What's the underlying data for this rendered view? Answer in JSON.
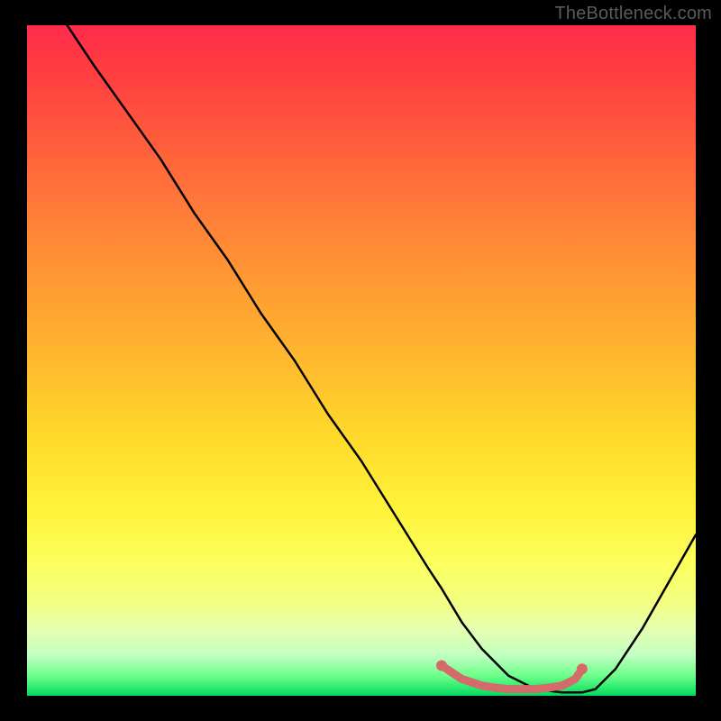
{
  "watermark": "TheBottleneck.com",
  "chart_data": {
    "type": "line",
    "title": "",
    "xlabel": "",
    "ylabel": "",
    "xlim": [
      0,
      100
    ],
    "ylim": [
      0,
      100
    ],
    "grid": false,
    "legend": false,
    "series": [
      {
        "name": "bottleneck-curve",
        "color": "#000000",
        "x": [
          6,
          10,
          15,
          20,
          25,
          30,
          35,
          40,
          45,
          50,
          55,
          60,
          62,
          65,
          68,
          72,
          76,
          80,
          83,
          85,
          88,
          92,
          96,
          100
        ],
        "y": [
          100,
          94,
          87,
          80,
          72,
          65,
          57,
          50,
          42,
          35,
          27,
          19,
          16,
          11,
          7,
          3,
          1,
          0.5,
          0.5,
          1,
          4,
          10,
          17,
          24
        ]
      },
      {
        "name": "optimal-range-marker",
        "color": "#d46a6a",
        "x": [
          62,
          65,
          68,
          70,
          72,
          74,
          76,
          78,
          80,
          82,
          83
        ],
        "y": [
          4.5,
          2.5,
          1.5,
          1.2,
          1.0,
          1.0,
          1.0,
          1.2,
          1.5,
          2.5,
          4.0
        ]
      }
    ],
    "gradient_stops": [
      {
        "pos": 0.0,
        "color": "#ff2b4b"
      },
      {
        "pos": 0.5,
        "color": "#ffdb2a"
      },
      {
        "pos": 0.85,
        "color": "#f2ff82"
      },
      {
        "pos": 1.0,
        "color": "#00d860"
      }
    ]
  }
}
